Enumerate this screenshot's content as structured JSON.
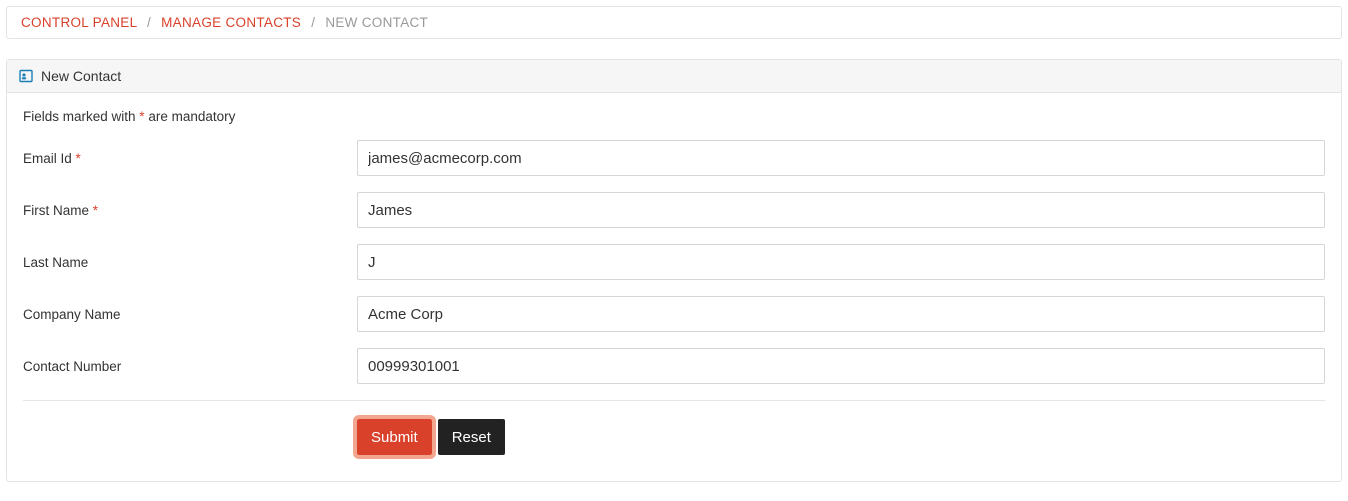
{
  "breadcrumb": {
    "items": [
      {
        "label": "CONTROL PANEL",
        "link": true
      },
      {
        "label": "MANAGE CONTACTS",
        "link": true
      },
      {
        "label": "NEW CONTACT",
        "link": false
      }
    ],
    "separator": "/"
  },
  "panel": {
    "title": "New Contact"
  },
  "mandatory_note": {
    "prefix": "Fields marked with ",
    "star": "*",
    "suffix": " are mandatory"
  },
  "fields": {
    "email": {
      "label": "Email Id ",
      "required": true,
      "value": "james@acmecorp.com"
    },
    "first_name": {
      "label": "First Name ",
      "required": true,
      "value": "James"
    },
    "last_name": {
      "label": "Last Name",
      "required": false,
      "value": "J"
    },
    "company": {
      "label": "Company Name",
      "required": false,
      "value": "Acme Corp"
    },
    "contact_number": {
      "label": "Contact Number",
      "required": false,
      "value": "00999301001"
    }
  },
  "buttons": {
    "submit": "Submit",
    "reset": "Reset"
  },
  "required_marker": "*"
}
